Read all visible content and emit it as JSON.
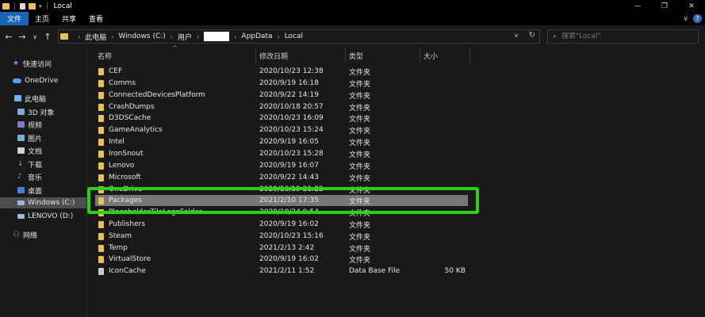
{
  "window": {
    "title": "Local",
    "controls": {
      "minimize": "—",
      "maximize": "❐",
      "close": "✕"
    }
  },
  "ribbon": {
    "tabs": [
      "文件",
      "主页",
      "共享",
      "查看"
    ]
  },
  "nav": {
    "back": "←",
    "forward": "→",
    "recent": "∨",
    "up": "↑"
  },
  "address": {
    "crumbs": [
      "此电脑",
      "Windows (C:)",
      "用户",
      "AppData",
      "Local"
    ]
  },
  "search": {
    "placeholder": "搜索\"Local\""
  },
  "sidebar": {
    "quick_access": "快速访问",
    "onedrive": "OneDrive",
    "this_pc": "此电脑",
    "objects3d": "3D 对象",
    "videos": "视频",
    "pictures": "图片",
    "documents": "文档",
    "downloads": "下载",
    "music": "音乐",
    "desktop": "桌面",
    "drive_c": "Windows (C:)",
    "drive_d": "LENOVO (D:)",
    "network": "网络"
  },
  "columns": {
    "name": "名称",
    "date": "修改日期",
    "type": "类型",
    "size": "大小"
  },
  "files": [
    {
      "name": "CEF",
      "date": "2020/10/23 12:38",
      "type": "文件夹",
      "size": ""
    },
    {
      "name": "Comms",
      "date": "2020/9/19 16:18",
      "type": "文件夹",
      "size": ""
    },
    {
      "name": "ConnectedDevicesPlatform",
      "date": "2020/9/22 14:19",
      "type": "文件夹",
      "size": ""
    },
    {
      "name": "CrashDumps",
      "date": "2020/10/18 20:57",
      "type": "文件夹",
      "size": ""
    },
    {
      "name": "D3DSCache",
      "date": "2020/10/23 16:09",
      "type": "文件夹",
      "size": ""
    },
    {
      "name": "GameAnalytics",
      "date": "2020/10/23 15:24",
      "type": "文件夹",
      "size": ""
    },
    {
      "name": "Intel",
      "date": "2020/9/19 16:05",
      "type": "文件夹",
      "size": ""
    },
    {
      "name": "IronSnout",
      "date": "2020/10/23 15:28",
      "type": "文件夹",
      "size": ""
    },
    {
      "name": "Lenovo",
      "date": "2020/9/19 16:07",
      "type": "文件夹",
      "size": ""
    },
    {
      "name": "Microsoft",
      "date": "2020/9/22 14:43",
      "type": "文件夹",
      "size": ""
    },
    {
      "name": "OneDrive",
      "date": "2020/10/19 21:22",
      "type": "文件夹",
      "size": ""
    },
    {
      "name": "Packages",
      "date": "2021/2/10 17:35",
      "type": "文件夹",
      "size": ""
    },
    {
      "name": "PlaceholderTileLogoFolder",
      "date": "2020/10/24 9:54",
      "type": "文件夹",
      "size": ""
    },
    {
      "name": "Publishers",
      "date": "2020/9/19 16:02",
      "type": "文件夹",
      "size": ""
    },
    {
      "name": "Steam",
      "date": "2020/10/23 15:16",
      "type": "文件夹",
      "size": ""
    },
    {
      "name": "Temp",
      "date": "2021/2/13 2:42",
      "type": "文件夹",
      "size": ""
    },
    {
      "name": "VirtualStore",
      "date": "2020/9/19 16:02",
      "type": "文件夹",
      "size": ""
    },
    {
      "name": "IconCache",
      "date": "2021/2/11 1:52",
      "type": "Data Base File",
      "size": "50 KB"
    }
  ],
  "colors": {
    "highlight": "#2bd01a",
    "accent_tab": "#1a64b6",
    "folder": "#e8c056"
  }
}
